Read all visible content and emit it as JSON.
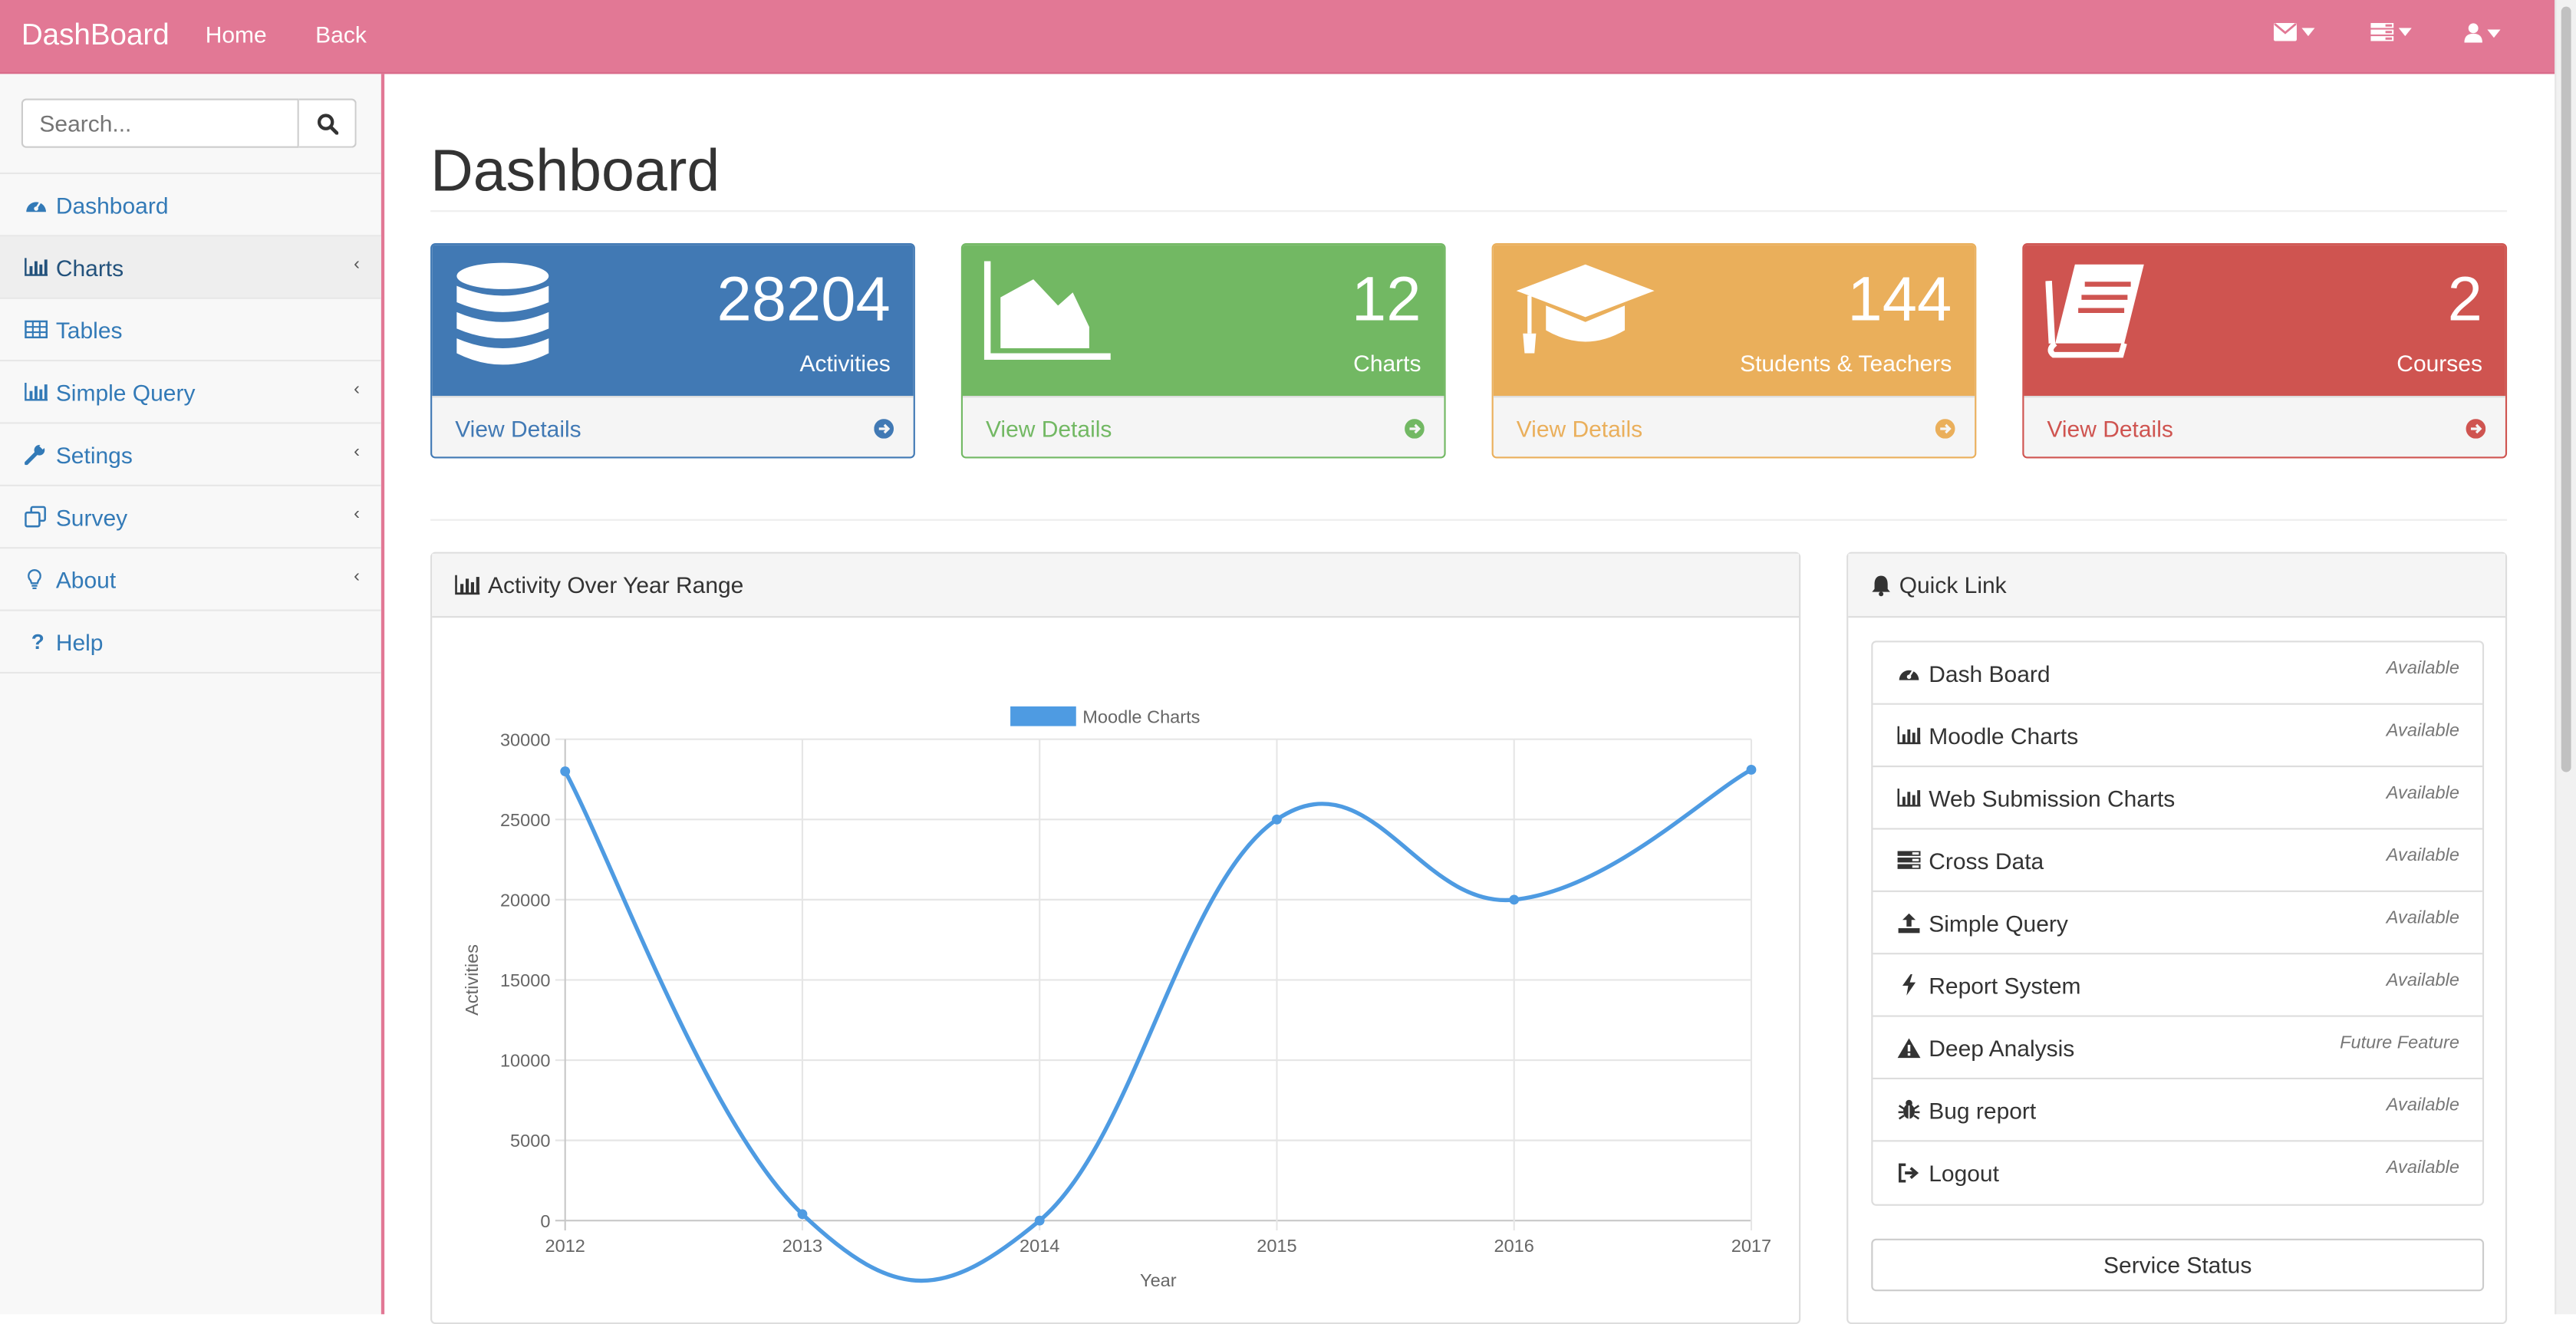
{
  "topbar": {
    "brand": "DashBoard",
    "links": [
      "Home",
      "Back"
    ],
    "icons": [
      "envelope-icon",
      "tasks-icon",
      "user-icon"
    ],
    "color": "#e27895"
  },
  "sidebar": {
    "search_placeholder": "Search...",
    "items": [
      {
        "label": "Dashboard",
        "icon": "dashboard-icon",
        "has_submenu": false
      },
      {
        "label": "Charts",
        "icon": "bar-chart-icon",
        "has_submenu": true
      },
      {
        "label": "Tables",
        "icon": "table-icon",
        "has_submenu": false
      },
      {
        "label": "Simple Query",
        "icon": "bar-chart-icon",
        "has_submenu": true
      },
      {
        "label": "Setings",
        "icon": "wrench-icon",
        "has_submenu": true
      },
      {
        "label": "Survey",
        "icon": "clone-icon",
        "has_submenu": true
      },
      {
        "label": "About",
        "icon": "lightbulb-icon",
        "has_submenu": true
      },
      {
        "label": "Help",
        "icon": "question-icon",
        "has_submenu": false
      }
    ]
  },
  "main": {
    "title": "Dashboard",
    "cards": [
      {
        "value": "28204",
        "label": "Activities",
        "link": "View Details",
        "color": "#4179b4",
        "icon": "database-icon"
      },
      {
        "value": "12",
        "label": "Charts",
        "link": "View Details",
        "color": "#72b863",
        "icon": "area-chart-icon"
      },
      {
        "value": "144",
        "label": "Students & Teachers",
        "link": "View Details",
        "color": "#eaaf5b",
        "icon": "graduation-cap-icon"
      },
      {
        "value": "2",
        "label": "Courses",
        "link": "View Details",
        "color": "#cf5450",
        "icon": "book-icon"
      }
    ],
    "chart_panel": {
      "title": "Activity Over Year Range"
    },
    "quick_link": {
      "title": "Quick Link",
      "items": [
        {
          "label": "Dash Board",
          "status": "Available",
          "icon": "dashboard-icon"
        },
        {
          "label": "Moodle Charts",
          "status": "Available",
          "icon": "bar-chart-icon"
        },
        {
          "label": "Web Submission Charts",
          "status": "Available",
          "icon": "bar-chart-icon"
        },
        {
          "label": "Cross Data",
          "status": "Available",
          "icon": "tasks-icon"
        },
        {
          "label": "Simple Query",
          "status": "Available",
          "icon": "upload-icon"
        },
        {
          "label": "Report System",
          "status": "Available",
          "icon": "bolt-icon"
        },
        {
          "label": "Deep Analysis",
          "status": "Future Feature",
          "icon": "warning-icon"
        },
        {
          "label": "Bug report",
          "status": "Available",
          "icon": "bug-icon"
        },
        {
          "label": "Logout",
          "status": "Available",
          "icon": "sign-out-icon"
        }
      ],
      "button": "Service Status"
    }
  },
  "chart_data": {
    "type": "line",
    "categories": [
      "2012",
      "2013",
      "2014",
      "2015",
      "2016",
      "2017"
    ],
    "series": [
      {
        "name": "Moodle Charts",
        "values": [
          28000,
          400,
          0,
          25000,
          20000,
          28100
        ],
        "color": "#4e9be2"
      }
    ],
    "xlabel": "Year",
    "ylabel": "Activities",
    "ylim": [
      0,
      30000
    ],
    "yticks": [
      0,
      5000,
      10000,
      15000,
      20000,
      25000,
      30000
    ],
    "legend": "top",
    "grid": true
  }
}
